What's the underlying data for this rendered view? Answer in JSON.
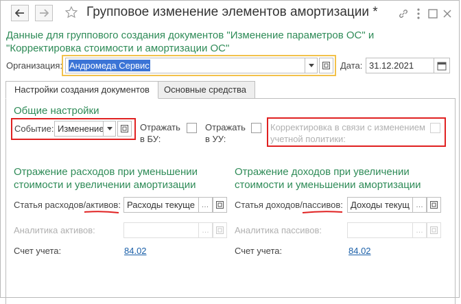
{
  "window": {
    "title": "Групповое изменение элементов амортизации *",
    "subtitle_line1": "Данные для группового создания документов \"Изменение параметров ОС\" и",
    "subtitle_line2": "\"Корректировка стоимости и амортизации ОС\""
  },
  "header_icons": [
    "star-icon",
    "link-icon",
    "more-icon",
    "maximize-icon",
    "close-icon"
  ],
  "organization": {
    "label": "Организация:",
    "value": "Андромеда Сервис"
  },
  "date": {
    "label": "Дата:",
    "value": "31.12.2021"
  },
  "tabs": [
    {
      "label": "Настройки создания документов",
      "active": true
    },
    {
      "label": "Основные средства",
      "active": false
    }
  ],
  "general": {
    "title": "Общие настройки",
    "event_label": "Событие:",
    "event_value": "Изменение",
    "reflect_bu_line1": "Отражать",
    "reflect_bu_line2": "в БУ:",
    "reflect_uu_line1": "Отражать",
    "reflect_uu_line2": "в УУ:",
    "correction_line1": "Корректировка в связи с изменением",
    "correction_line2": "учетной политики:"
  },
  "expenses": {
    "title_line1": "Отражение расходов при уменьшении",
    "title_line2": "стоимости и увеличении амортизации",
    "article_label_main": "Статья расходов/",
    "article_label_emph": "активов",
    "article_label_tail": ":",
    "article_value": "Расходы текуще",
    "analytics_label": "Аналитика активов:",
    "account_label": "Счет учета:",
    "account_value": "84.02"
  },
  "income": {
    "title_line1": "Отражение доходов при увеличении",
    "title_line2": "стоимости и уменьшении амортизации",
    "article_label_main": "Статья доходов/",
    "article_label_emph": "пассивов",
    "article_label_tail": ":",
    "article_value": "Доходы текущ",
    "analytics_label": "Аналитика пассивов:",
    "account_label": "Счет учета:",
    "account_value": "84.02"
  },
  "colors": {
    "accent_green": "#2e8b57",
    "highlight_red": "#e02020",
    "highlight_yellow": "#f2c14a",
    "selection_blue": "#3b74d6",
    "link_blue": "#1a5fa8"
  }
}
